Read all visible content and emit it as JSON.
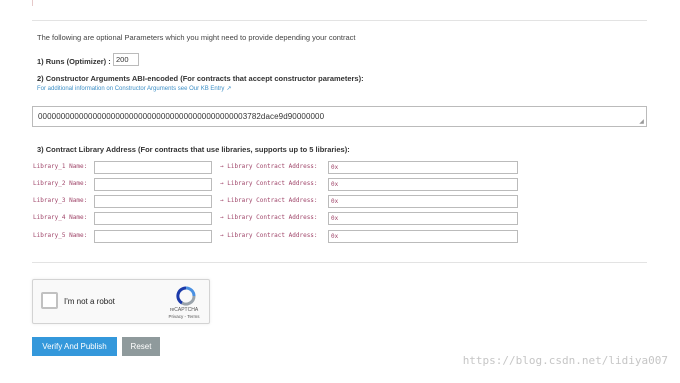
{
  "intro_text": "The following are optional Parameters which you might need to provide depending your contract",
  "runs": {
    "label": "1) Runs (Optimizer) :",
    "value": "200"
  },
  "constructor": {
    "label": "2) Constructor Arguments ABI-encoded (For contracts that accept constructor parameters):",
    "kb_link": "For additional information on Constructor Arguments see Our KB Entry",
    "abi_value": "0000000000000000000000000000000000000000000003782dace9d90000000"
  },
  "libraries": {
    "title": "3) Contract Library Address (For contracts that use libraries, supports up to 5 libraries):",
    "arrow_label": "→ Library Contract Address:",
    "address_placeholder": "0x",
    "rows": [
      {
        "name_label": "Library_1 Name:"
      },
      {
        "name_label": "Library_2 Name:"
      },
      {
        "name_label": "Library_3 Name:"
      },
      {
        "name_label": "Library_4 Name:"
      },
      {
        "name_label": "Library_5 Name:"
      }
    ]
  },
  "captcha": {
    "checkbox_label": "I'm not a robot",
    "brand": "reCAPTCHA",
    "links": "Privacy - Terms"
  },
  "buttons": {
    "verify": "Verify And Publish",
    "reset": "Reset"
  },
  "watermark": "https://blog.csdn.net/lidiya007",
  "colors": {
    "accent": "#3498db",
    "reset": "#8f9a9c",
    "mono_label": "#a0466a",
    "link": "#3d8fc6"
  }
}
